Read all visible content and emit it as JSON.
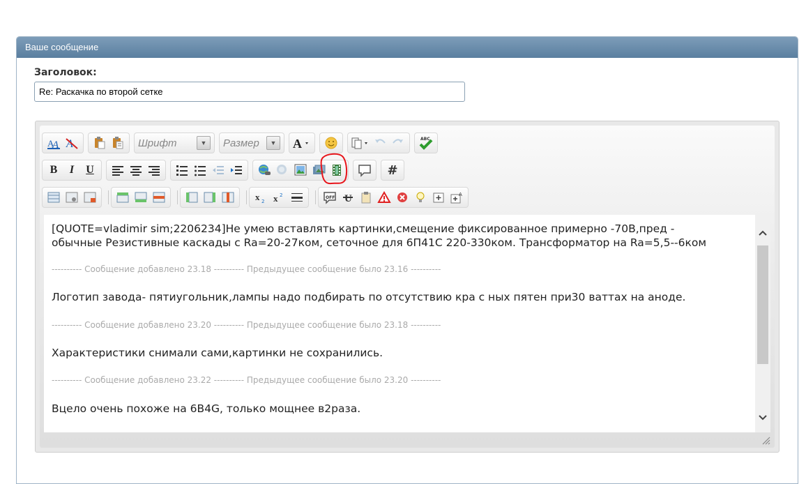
{
  "panel": {
    "title": "Ваше сообщение"
  },
  "form": {
    "title_label": "Заголовок:",
    "title_value": "Re: Раскачка по второй сетке"
  },
  "toolbar": {
    "font_select": "Шрифт",
    "size_select": "Размер",
    "bold": "B",
    "italic": "I",
    "underline": "U",
    "hash": "#"
  },
  "content": {
    "p1_line1": "[QUOTE=vladimir sim;2206234]Не умею вставлять картинки,смещение фиксированное примерно -70В,пред -",
    "p1_line2": "обычные Резистивные каскады с Ra=20-27ком, сеточное для 6П41С 220-330ком. Трансформатор на Ra=5,5--6ком",
    "note1": "---------- Сообщение добавлено 23.18 ---------- Предыдущее сообщение было 23.16 ----------",
    "p2": "Логотип завода- пятиугольник,лампы надо подбирать по отсутствию кра с ных пятен при30 ваттах на аноде.",
    "note2": "---------- Сообщение добавлено 23.20 ---------- Предыдущее сообщение было 23.18 ----------",
    "p3": "Характеристики снимали сами,картинки не сохранились.",
    "note3": "---------- Сообщение добавлено 23.22 ---------- Предыдущее сообщение было 23.20 ----------",
    "p4": "Вцело очень похоже на 6B4G, только мощнее в2раза."
  },
  "colors": {
    "header_bg": "#6a8dab",
    "highlight_circle": "#e8151b",
    "text": "#222222",
    "note_text": "#aaaaaa"
  }
}
